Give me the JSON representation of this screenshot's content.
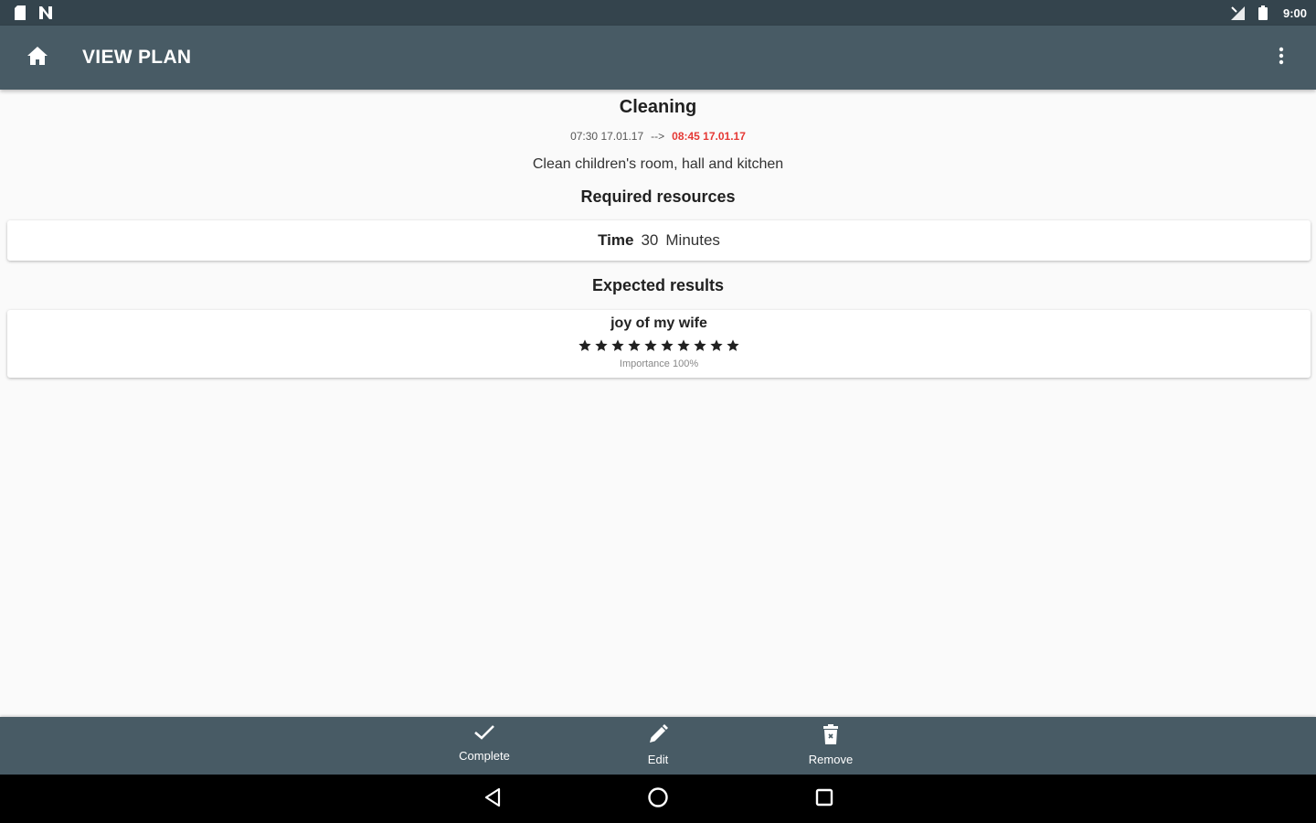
{
  "status_bar": {
    "time": "9:00",
    "icons": [
      "sd-card-icon",
      "notification-n-icon",
      "signal-icon",
      "battery-icon"
    ]
  },
  "app_bar": {
    "title": "VIEW PLAN",
    "icons": [
      "home-icon",
      "more-vert-icon"
    ]
  },
  "plan": {
    "title": "Cleaning",
    "start": "07:30 17.01.17",
    "arrow": "-->",
    "end": "08:45 17.01.17",
    "description": "Clean children's room, hall and kitchen"
  },
  "required_resources": {
    "header": "Required resources",
    "items": [
      {
        "name": "Time",
        "amount": "30",
        "unit": "Minutes"
      }
    ]
  },
  "expected_results": {
    "header": "Expected results",
    "items": [
      {
        "name": "joy of my wife",
        "stars": 10,
        "importance": "Importance 100%"
      }
    ]
  },
  "actions": {
    "complete": "Complete",
    "edit": "Edit",
    "remove": "Remove"
  },
  "colors": {
    "status_bar": "#34444d",
    "app_bar": "#485b65",
    "end_date": "#e53935",
    "background": "#fafafa"
  }
}
